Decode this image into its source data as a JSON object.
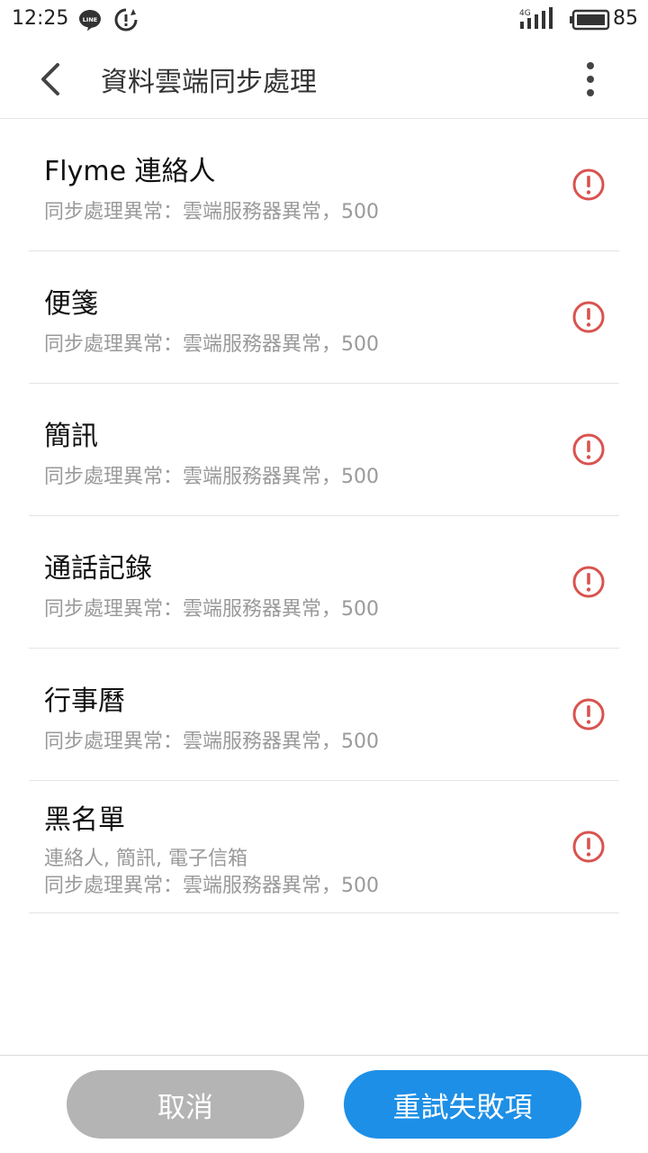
{
  "status_bar": {
    "time": "12:25",
    "line_badge": "LINE",
    "network": "4G",
    "battery": "85"
  },
  "header": {
    "title": "資料雲端同步處理"
  },
  "items": [
    {
      "title": "Flyme 連絡人",
      "detail": "",
      "status": "同步處理異常：雲端服務器異常，500"
    },
    {
      "title": "便箋",
      "detail": "",
      "status": "同步處理異常：雲端服務器異常，500"
    },
    {
      "title": "簡訊",
      "detail": "",
      "status": "同步處理異常：雲端服務器異常，500"
    },
    {
      "title": "通話記錄",
      "detail": "",
      "status": "同步處理異常：雲端服務器異常，500"
    },
    {
      "title": "行事曆",
      "detail": "",
      "status": "同步處理異常：雲端服務器異常，500"
    },
    {
      "title": "黑名單",
      "detail": "連絡人, 簡訊, 電子信箱",
      "status": "同步處理異常：雲端服務器異常，500"
    }
  ],
  "buttons": {
    "cancel": "取消",
    "retry": "重試失敗項"
  },
  "colors": {
    "alert": "#d9534f",
    "primary": "#1e8fe6",
    "disabled": "#b4b4b4"
  }
}
